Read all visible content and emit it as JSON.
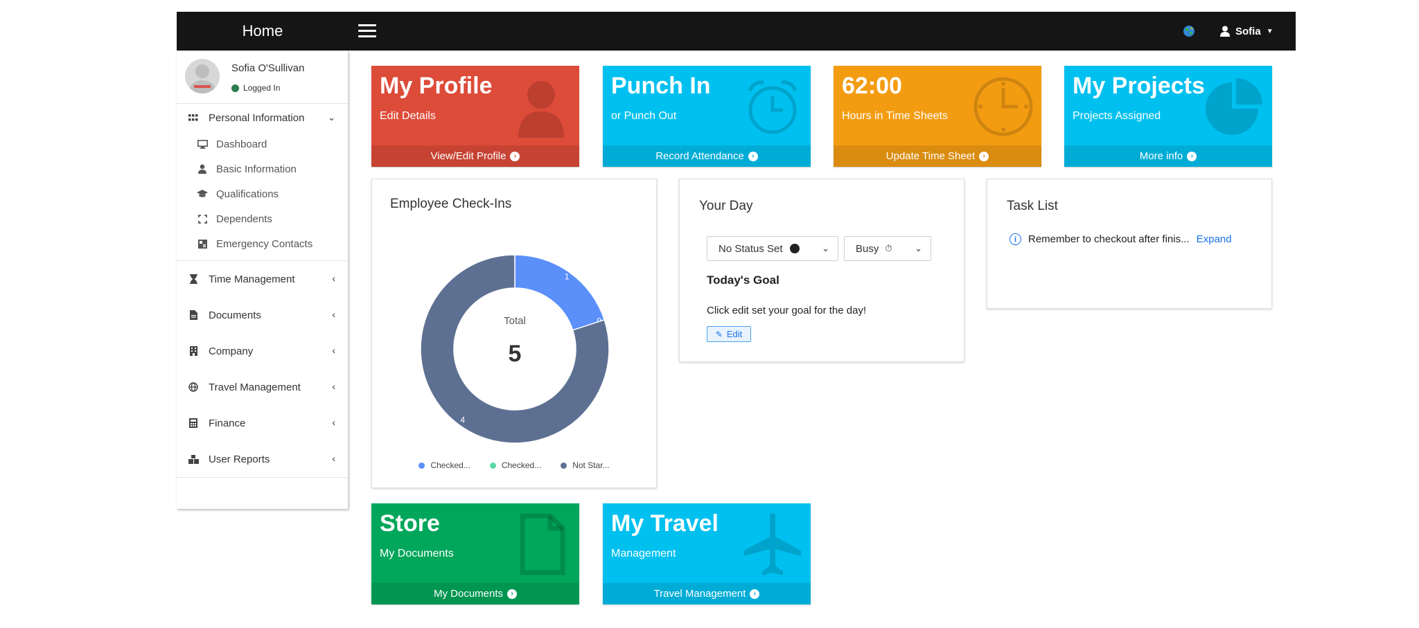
{
  "topbar": {
    "brand": "Home",
    "user_name": "Sofia"
  },
  "sidebar": {
    "user": {
      "name": "Sofia O'Sullivan",
      "status": "Logged In"
    },
    "group": {
      "label": "Personal Information",
      "items": [
        {
          "label": "Dashboard",
          "icon": "monitor-icon"
        },
        {
          "label": "Basic Information",
          "icon": "user-icon"
        },
        {
          "label": "Qualifications",
          "icon": "graduation-cap-icon"
        },
        {
          "label": "Dependents",
          "icon": "expand-icon"
        },
        {
          "label": "Emergency Contacts",
          "icon": "address-card-icon"
        }
      ]
    },
    "items": [
      {
        "label": "Time Management",
        "icon": "hourglass-icon"
      },
      {
        "label": "Documents",
        "icon": "file-icon"
      },
      {
        "label": "Company",
        "icon": "building-icon"
      },
      {
        "label": "Travel Management",
        "icon": "globe-icon"
      },
      {
        "label": "Finance",
        "icon": "calculator-icon"
      },
      {
        "label": "User Reports",
        "icon": "cubes-icon"
      }
    ]
  },
  "boxes": {
    "profile": {
      "title": "My Profile",
      "subtitle": "Edit Details",
      "footer": "View/Edit Profile",
      "color": "#dd4b39"
    },
    "punch": {
      "title": "Punch In",
      "subtitle": "or Punch Out",
      "footer": "Record Attendance",
      "color": "#00c0ef"
    },
    "time": {
      "title": "62:00",
      "subtitle": "Hours in Time Sheets",
      "footer": "Update Time Sheet",
      "color": "#f39c12"
    },
    "projects": {
      "title": "My Projects",
      "subtitle": "Projects Assigned",
      "footer": "More info",
      "color": "#00c0ef"
    },
    "store": {
      "title": "Store",
      "subtitle": "My Documents",
      "footer": "My Documents",
      "color": "#00a65a"
    },
    "travel": {
      "title": "My Travel",
      "subtitle": "Management",
      "footer": "Travel Management",
      "color": "#00c0ef"
    }
  },
  "checkins": {
    "title": "Employee Check-Ins",
    "center_label": "Total",
    "center_value": "5"
  },
  "chart_data": {
    "type": "pie",
    "title": "Employee Check-Ins",
    "categories": [
      "Checked...",
      "Checked...",
      "Not Star..."
    ],
    "values": [
      1,
      0,
      4
    ],
    "colors": [
      "#5b8ff9",
      "#5ad8a6",
      "#5d7092"
    ],
    "total": 5,
    "legend_position": "bottom"
  },
  "your_day": {
    "title": "Your Day",
    "status_select": "No Status Set",
    "busy_select": "Busy",
    "goal_title": "Today's Goal",
    "goal_text": "Click edit set your goal for the day!",
    "edit_label": "Edit"
  },
  "tasks": {
    "title": "Task List",
    "item": "Remember to checkout after finis...",
    "expand_label": "Expand"
  }
}
